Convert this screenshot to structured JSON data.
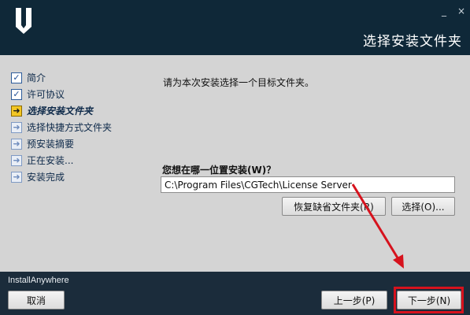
{
  "window": {
    "title": "选择安装文件夹",
    "controls": {
      "minimize": "_",
      "close": "×"
    }
  },
  "sidebar": {
    "items": [
      {
        "label": "简介",
        "state": "done",
        "icon": "check-icon"
      },
      {
        "label": "许可协议",
        "state": "done",
        "icon": "check-icon"
      },
      {
        "label": "选择安装文件夹",
        "state": "current",
        "icon": "arrow-right-icon"
      },
      {
        "label": "选择快捷方式文件夹",
        "state": "pending",
        "icon": "arrow-right-icon"
      },
      {
        "label": "预安装摘要",
        "state": "pending",
        "icon": "arrow-right-icon"
      },
      {
        "label": "正在安装...",
        "state": "pending",
        "icon": "arrow-right-icon"
      },
      {
        "label": "安装完成",
        "state": "pending",
        "icon": "arrow-right-icon"
      }
    ]
  },
  "main": {
    "instruction": "请为本次安装选择一个目标文件夹。",
    "question": "您想在哪一位置安装(W)？",
    "install_path": "C:\\Program Files\\CGTech\\License Server",
    "restore_default_label": "恢复缺省文件夹(R)",
    "choose_label": "选择(O)..."
  },
  "footer": {
    "brand": "InstallAnywhere",
    "cancel_label": "取消",
    "prev_label": "上一步(P)",
    "next_label": "下一步(N)"
  },
  "colors": {
    "header_bg": "#0f2838",
    "content_bg": "#d4d4d4",
    "annotation_red": "#d6121d"
  }
}
